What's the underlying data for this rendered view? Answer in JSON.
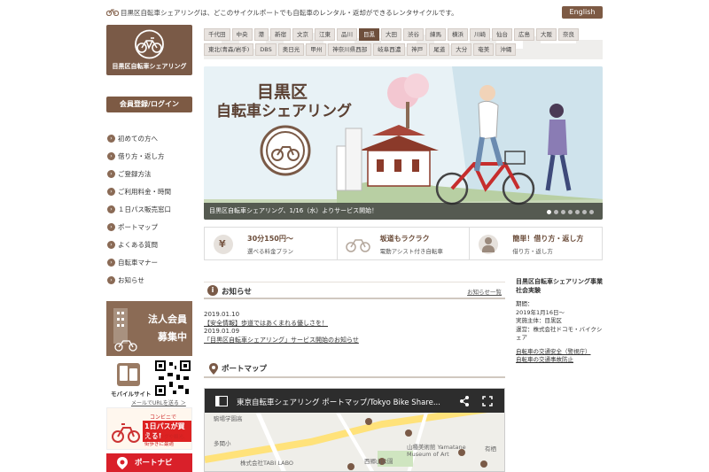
{
  "header": {
    "intro_text": "目黒区自転車シェアリングは、どこのサイクルポートでも自転車のレンタル・返却ができるレンタサイクルです。",
    "english_label": "English"
  },
  "logo": {
    "text": "目黒区自転車シェアリング"
  },
  "tabs": {
    "row1": [
      "千代田",
      "中央",
      "港",
      "新宿",
      "文京",
      "江東",
      "品川",
      "目黒",
      "大田",
      "渋谷",
      "練馬",
      "横浜",
      "川崎",
      "仙台",
      "広島",
      "大阪",
      "奈良"
    ],
    "row2": [
      "東北(青森/岩手)",
      "DBS",
      "奥日光",
      "甲州",
      "神奈川県西部",
      "岐阜西濃",
      "神戸",
      "尾道",
      "大分",
      "奄美",
      "沖縄"
    ],
    "active": "目黒"
  },
  "sidebar": {
    "member_button": "会員登録/ログイン",
    "menu": [
      {
        "label": "初めての方へ"
      },
      {
        "label": "借り方・返し方"
      },
      {
        "label": "ご登録方法"
      },
      {
        "label": "ご利用料金・時間"
      },
      {
        "label": "１日パス販売窓口"
      },
      {
        "label": "ポートマップ"
      },
      {
        "label": "よくある質問"
      },
      {
        "label": "自転車マナー"
      },
      {
        "label": "お知らせ"
      }
    ],
    "corp_banner": {
      "line1": "法人会員",
      "line2": "募集中"
    },
    "mobile": {
      "label": "モバイルサイト",
      "link": "メールでURLを送る ＞"
    },
    "conbini": {
      "line1": "コンビニで",
      "line2": "1日パスが買える!",
      "line3": "ポタリングや観光、街歩きに最適"
    },
    "portnavi": "ポートナビ"
  },
  "hero": {
    "title_line1": "目黒区",
    "title_line2": "自転車シェアリング",
    "caption": "目黒区自転車シェアリング、1/16（水）よりサービス開始！",
    "slide_count": 7,
    "active_slide": 1
  },
  "features": [
    {
      "icon": "yen-icon",
      "title": "30分150円〜",
      "sub": "選べる料金プラン"
    },
    {
      "icon": "bicycle-icon",
      "title": "坂道もラクラク",
      "sub": "電動アシスト付き自転車"
    },
    {
      "icon": "person-icon",
      "title": "簡単！借り方・返し方",
      "sub": "借り方・返し方"
    }
  ],
  "news": {
    "title": "お知らせ",
    "more": "お知らせ一覧",
    "items": [
      {
        "date": "2019.01.10",
        "text": "【安全情報】歩道ではあくまれる優しさを！"
      },
      {
        "date": "2019.01.09",
        "text": "「目黒区自転車シェアリング」サービス開始のお知らせ"
      }
    ]
  },
  "portmap": {
    "title": "ポートマップ",
    "embed_title": "東京自転車シェアリング ポートマップ/Tokyo Bike Share...",
    "labels": [
      "駒場学園高",
      "多聞小",
      "株式会社TABI LABO",
      "西郷山公園",
      "山種美術館 Yamatane Museum of Art",
      "有栖"
    ]
  },
  "project": {
    "title": "目黒区自転車シェアリング事業社会実験",
    "period_label": "期間：",
    "period": "2019年1月16日〜",
    "host": "実施主体：目黒区",
    "operator": "運営：株式会社ドコモ・バイクシェア",
    "links": [
      "自転車の交通安全（警視庁）",
      "自転車の交通事故防止"
    ]
  },
  "colors": {
    "brand_brown": "#7a5a47",
    "active_tab": "#6e4f3c",
    "portnavi_red": "#d9202a"
  }
}
